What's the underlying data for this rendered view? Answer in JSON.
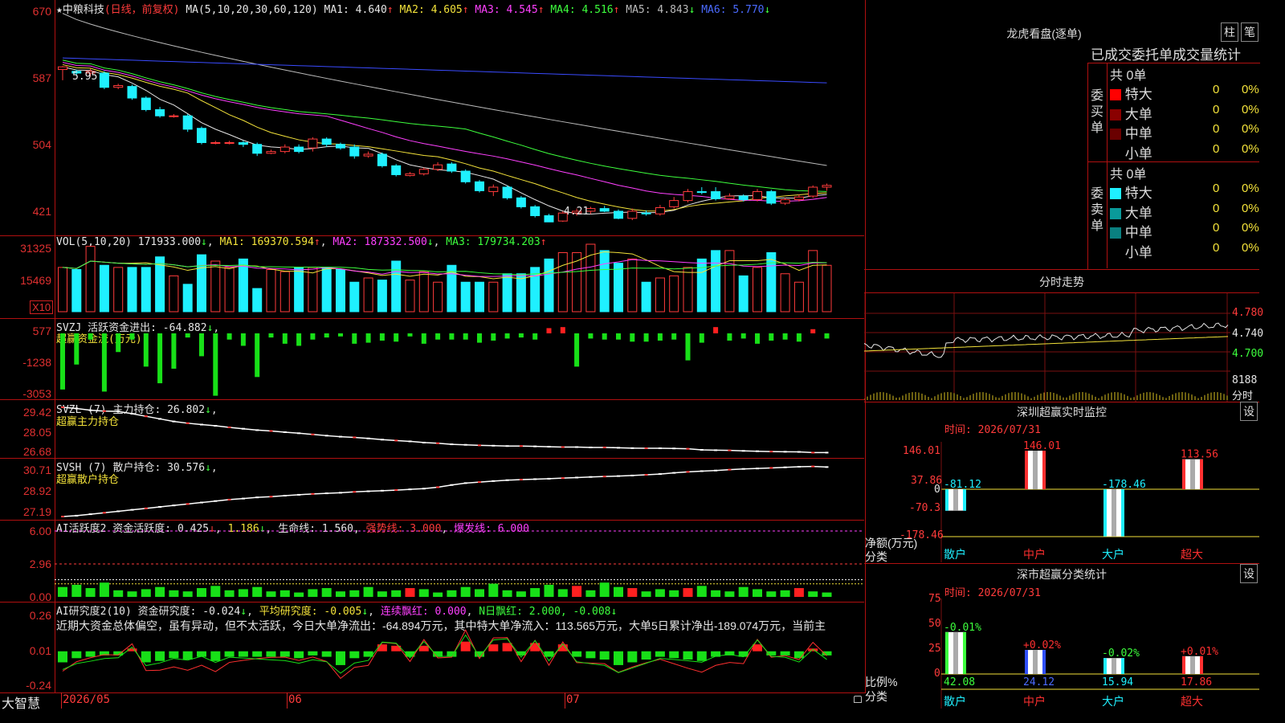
{
  "stock": {
    "name": "中粮科技",
    "mode": "(日线，前复权)"
  },
  "ma_header": {
    "label": "MA(5,10,20,30,60,120)",
    "ma1": "MA1: 4.640",
    "ma2": "MA2: 4.605",
    "ma3": "MA3: 4.545",
    "ma4": "MA4: 4.516",
    "ma5": "MA5: 4.843",
    "ma6": "MA6: 5.770"
  },
  "arrows": {
    "up": "↑",
    "down": "↓"
  },
  "price_axis": [
    "670",
    "587",
    "504",
    "421"
  ],
  "price_annot": {
    "high": "5.95",
    "low": "4.21"
  },
  "vol_header": {
    "label": "VOL(5,10,20)",
    "vol": "171933.000",
    "ma1": "MA1: 169370.594",
    "ma2": "MA2: 187332.500",
    "ma3": "MA3: 179734.203"
  },
  "vol_axis": [
    "31325",
    "15469",
    "X10"
  ],
  "svzj": {
    "label": "SVZJ  活跃资金进出: -64.882",
    "sub": "超赢资金流(万元)",
    "axis": [
      "577",
      "-1238",
      "-3053"
    ]
  },
  "svzl": {
    "label": "SVZL (7) 主力持仓: 26.802",
    "sub": "超赢主力持仓",
    "axis": [
      "29.42",
      "28.05",
      "26.68"
    ]
  },
  "svsh": {
    "label": "SVSH (7) 散户持仓: 30.576",
    "sub": "超赢散户持仓",
    "axis": [
      "30.71",
      "28.92",
      "27.19"
    ]
  },
  "ai1": {
    "label": "AI活跃度2 资金活跃度: 0.425",
    "v2": "1.186",
    "life": "生命线: 1.560",
    "strong": "强势线: 3.000",
    "burst": "爆发线: 6.000",
    "axis": [
      "6.00",
      "2.96",
      "0.00"
    ]
  },
  "ai2": {
    "label": "AI研究度2(10) 资金研究度: -0.024",
    "avg": "平均研究度: -0.005",
    "red": "连续飘红: 0.000",
    "nred": "N日飘红: 2.000, -0.008",
    "commentary": "近期大资金总体偏空，虽有异动，但不太活跃，今日大单净流出：-64.894万元，其中特大单净流入：113.565万元，大单5日累计净出-189.074万元，当前主",
    "axis": [
      "0.26",
      "0.01",
      "-0.24"
    ]
  },
  "xaxis": {
    "brand": "大智慧",
    "dates": [
      "2026/05",
      "06",
      "07"
    ]
  },
  "lhb": {
    "title": "龙虎看盘(逐单)",
    "tabs": [
      "柱",
      "笔"
    ],
    "subtitle": "已成交委托单成交量统计",
    "buy": {
      "side": "委买单",
      "total": "共 0单",
      "rows": [
        {
          "name": "特大",
          "count": "0",
          "pct": "0%",
          "color": "#ff0000"
        },
        {
          "name": "大单",
          "count": "0",
          "pct": "0%",
          "color": "#8a0000"
        },
        {
          "name": "中单",
          "count": "0",
          "pct": "0%",
          "color": "#6a0000"
        },
        {
          "name": "小单",
          "count": "0",
          "pct": "0%",
          "color": "#000000"
        }
      ]
    },
    "sell": {
      "side": "委卖单",
      "total": "共 0单",
      "rows": [
        {
          "name": "特大",
          "count": "0",
          "pct": "0%",
          "color": "#1ff0ff"
        },
        {
          "name": "大单",
          "count": "0",
          "pct": "0%",
          "color": "#0a9a9a"
        },
        {
          "name": "中单",
          "count": "0",
          "pct": "0%",
          "color": "#0a8080"
        },
        {
          "name": "小单",
          "count": "0",
          "pct": "0%",
          "color": "#000000"
        }
      ]
    }
  },
  "intraday": {
    "title": "分时走势",
    "axis": [
      "4.780",
      "4.740",
      "4.700"
    ],
    "vol_max": "8188",
    "vol_label": "分时"
  },
  "sz_monitor": {
    "title": "深圳超赢实时监控",
    "set": "设",
    "time": "时间: 2026/07/31",
    "axis": [
      "146.01",
      "37.86",
      "0",
      "-70.3",
      "-178.46"
    ],
    "ylabel": "净额(万元)",
    "xlabel": "分类",
    "cats": [
      "散户",
      "中户",
      "大户",
      "超大"
    ],
    "values": [
      "-81.12",
      "146.01",
      "-178.46",
      "113.56"
    ]
  },
  "sz_stats": {
    "title": "深市超赢分类统计",
    "set": "设",
    "time": "时间: 2026/07/31",
    "axis": [
      "75",
      "50",
      "25",
      "0"
    ],
    "ylabel": "比例%",
    "xlabel": "分类",
    "cats": [
      "散户",
      "中户",
      "大户",
      "超大"
    ],
    "values": [
      "42.08",
      "24.12",
      "15.94",
      "17.86"
    ],
    "changes": [
      "-0.01%",
      "+0.02%",
      "-0.02%",
      "+0.01%"
    ]
  },
  "chart_data": [
    {
      "type": "candlestick",
      "title": "中粮科技(日线，前复权)",
      "note": "open/close/high/low are estimates read from the price axis",
      "ylim": [
        4.05,
        6.7
      ],
      "ohlc": [
        [
          5.92,
          5.95,
          5.8,
          5.96
        ],
        [
          5.9,
          5.88,
          5.86,
          5.92
        ],
        [
          5.88,
          5.9,
          5.84,
          5.93
        ],
        [
          5.88,
          5.72,
          5.7,
          5.9
        ],
        [
          5.72,
          5.74,
          5.7,
          5.76
        ],
        [
          5.73,
          5.6,
          5.58,
          5.75
        ],
        [
          5.6,
          5.47,
          5.45,
          5.62
        ],
        [
          5.47,
          5.4,
          5.38,
          5.5
        ],
        [
          5.4,
          5.4,
          5.38,
          5.42
        ],
        [
          5.4,
          5.25,
          5.22,
          5.42
        ],
        [
          5.26,
          5.1,
          5.08,
          5.28
        ],
        [
          5.1,
          5.1,
          5.08,
          5.12
        ],
        [
          5.1,
          5.1,
          5.08,
          5.12
        ],
        [
          5.1,
          5.08,
          5.05,
          5.12
        ],
        [
          5.08,
          4.98,
          4.95,
          5.1
        ],
        [
          4.98,
          5.0,
          4.97,
          5.02
        ],
        [
          5.0,
          5.05,
          4.98,
          5.08
        ],
        [
          5.05,
          5.0,
          4.98,
          5.08
        ],
        [
          5.04,
          5.14,
          5.0,
          5.16
        ],
        [
          5.14,
          5.08,
          5.05,
          5.16
        ],
        [
          5.08,
          5.04,
          5.02,
          5.1
        ],
        [
          5.05,
          4.95,
          4.92,
          5.08
        ],
        [
          4.95,
          4.97,
          4.93,
          5.0
        ],
        [
          4.97,
          4.84,
          4.82,
          4.99
        ],
        [
          4.84,
          4.74,
          4.72,
          4.86
        ],
        [
          4.73,
          4.75,
          4.72,
          4.77
        ],
        [
          4.75,
          4.8,
          4.73,
          4.82
        ],
        [
          4.8,
          4.85,
          4.78,
          4.88
        ],
        [
          4.86,
          4.78,
          4.76,
          4.88
        ],
        [
          4.78,
          4.66,
          4.64,
          4.8
        ],
        [
          4.66,
          4.56,
          4.54,
          4.68
        ],
        [
          4.55,
          4.6,
          4.5,
          4.63
        ],
        [
          4.6,
          4.48,
          4.46,
          4.62
        ],
        [
          4.48,
          4.38,
          4.36,
          4.5
        ],
        [
          4.38,
          4.28,
          4.26,
          4.4
        ],
        [
          4.28,
          4.21,
          4.21,
          4.3
        ],
        [
          4.22,
          4.31,
          4.21,
          4.33
        ],
        [
          4.31,
          4.33,
          4.28,
          4.36
        ],
        [
          4.33,
          4.36,
          4.3,
          4.38
        ],
        [
          4.36,
          4.33,
          4.32,
          4.39
        ],
        [
          4.33,
          4.25,
          4.24,
          4.35
        ],
        [
          4.25,
          4.33,
          4.23,
          4.36
        ],
        [
          4.31,
          4.3,
          4.28,
          4.34
        ],
        [
          4.3,
          4.37,
          4.28,
          4.4
        ],
        [
          4.38,
          4.45,
          4.36,
          4.49
        ],
        [
          4.45,
          4.55,
          4.43,
          4.58
        ],
        [
          4.55,
          4.54,
          4.52,
          4.6
        ],
        [
          4.55,
          4.47,
          4.45,
          4.6
        ],
        [
          4.47,
          4.5,
          4.46,
          4.53
        ],
        [
          4.5,
          4.46,
          4.44,
          4.52
        ],
        [
          4.46,
          4.55,
          4.44,
          4.58
        ],
        [
          4.55,
          4.42,
          4.4,
          4.57
        ],
        [
          4.42,
          4.46,
          4.4,
          4.48
        ],
        [
          4.46,
          4.49,
          4.44,
          4.52
        ],
        [
          4.5,
          4.6,
          4.48,
          4.62
        ],
        [
          4.6,
          4.62,
          4.56,
          4.64
        ]
      ]
    },
    {
      "type": "bar",
      "title": "VOL(5,10,20)",
      "note": "volume in units of 10 lots (X10), estimated",
      "values": [
        21,
        20,
        31,
        22,
        21,
        21,
        21,
        26,
        17,
        13,
        27,
        24,
        21,
        25,
        11,
        20,
        19,
        21,
        21,
        21,
        20,
        14,
        16,
        15,
        24,
        15,
        19,
        14,
        22,
        14,
        14,
        14,
        18,
        18,
        21,
        25,
        28,
        28,
        32,
        29,
        23,
        25,
        14,
        16,
        17,
        21,
        25,
        29,
        29,
        17,
        21,
        28,
        18,
        14,
        29,
        22
      ],
      "ma_values": {
        "MA1": 169370.594,
        "MA2": 187332.5,
        "MA3": 179734.203
      }
    },
    {
      "type": "bar",
      "title": "SVZJ 活跃资金进出",
      "ylabel": "超赢资金流(万元)",
      "ylim": [
        -3053,
        577
      ],
      "values": [
        -2700,
        -1500,
        -300,
        -2800,
        -900,
        -300,
        -1600,
        -2400,
        -1700,
        -200,
        -1100,
        -3000,
        -300,
        -600,
        -2100,
        -200,
        -500,
        -600,
        -300,
        -200,
        -150,
        -500,
        -450,
        -350,
        -400,
        -150,
        -500,
        -300,
        -300,
        -300,
        -450,
        -350,
        -250,
        -200,
        -300,
        250,
        300,
        -1600,
        -250,
        -300,
        -300,
        -400,
        -400,
        -350,
        -300,
        -1300,
        -450,
        300,
        -350,
        -250,
        -500,
        -350,
        -300,
        -400,
        200,
        -250
      ]
    },
    {
      "type": "line",
      "title": "SVZL (7) 主力持仓",
      "ylabel": "超赢主力持仓",
      "ylim": [
        26.68,
        29.42
      ],
      "values": [
        29.42,
        29.35,
        29.25,
        29.2,
        29.18,
        29.05,
        28.9,
        28.75,
        28.6,
        28.5,
        28.42,
        28.35,
        28.26,
        28.18,
        28.1,
        28.05,
        27.98,
        27.92,
        27.85,
        27.78,
        27.72,
        27.68,
        27.62,
        27.55,
        27.5,
        27.45,
        27.38,
        27.34,
        27.28,
        27.25,
        27.22,
        27.2,
        27.18,
        27.18,
        27.16,
        27.14,
        27.12,
        27.12,
        27.1,
        27.1,
        27.08,
        27.06,
        27.05,
        27.05,
        27.04,
        27.02,
        26.96,
        26.94,
        26.93,
        26.9,
        26.88,
        26.86,
        26.85,
        26.84,
        26.8,
        26.8
      ]
    },
    {
      "type": "line",
      "title": "SVSH (7) 散户持仓",
      "ylabel": "超赢散户持仓",
      "ylim": [
        27.19,
        30.71
      ],
      "values": [
        27.19,
        27.25,
        27.35,
        27.45,
        27.55,
        27.65,
        27.75,
        27.85,
        27.95,
        28.05,
        28.15,
        28.25,
        28.35,
        28.42,
        28.5,
        28.55,
        28.62,
        28.68,
        28.74,
        28.78,
        28.82,
        28.88,
        28.92,
        28.96,
        29.0,
        29.05,
        29.1,
        29.2,
        29.35,
        29.48,
        29.55,
        29.62,
        29.68,
        29.72,
        29.75,
        29.78,
        29.82,
        29.86,
        29.9,
        29.93,
        29.96,
        30.0,
        30.05,
        30.1,
        30.18,
        30.25,
        30.3,
        30.34,
        30.4,
        30.45,
        30.48,
        30.52,
        30.56,
        30.6,
        30.62,
        30.58
      ]
    },
    {
      "type": "bar",
      "title": "AI活跃度2",
      "ylim": [
        0,
        6.0
      ],
      "lines": {
        "资金活跃度": 0.425,
        "生命线": 1.56,
        "强势线": 3.0,
        "爆发线": 6.0
      },
      "values": [
        0.9,
        1.1,
        0.8,
        1.3,
        0.6,
        0.5,
        0.7,
        0.9,
        0.6,
        0.5,
        0.8,
        1.0,
        0.6,
        0.7,
        0.9,
        0.5,
        0.6,
        0.4,
        0.7,
        0.8,
        0.5,
        0.6,
        0.9,
        0.5,
        0.6,
        0.8,
        0.7,
        0.4,
        0.6,
        0.9,
        0.7,
        1.2,
        0.6,
        0.5,
        0.8,
        1.1,
        0.7,
        1.0,
        0.6,
        1.3,
        0.9,
        0.8,
        0.5,
        0.7,
        0.6,
        0.8,
        1.0,
        0.6,
        0.5,
        0.9,
        0.7,
        0.5,
        0.6,
        0.8,
        0.5,
        0.4
      ]
    },
    {
      "type": "bar",
      "title": "AI研究度2(10)",
      "ylim": [
        -0.24,
        0.26
      ],
      "values": [
        -0.08,
        -0.05,
        -0.04,
        -0.03,
        -0.03,
        0.02,
        -0.08,
        -0.07,
        -0.05,
        -0.06,
        -0.04,
        -0.07,
        -0.04,
        -0.04,
        -0.04,
        -0.04,
        -0.04,
        -0.05,
        -0.03,
        -0.04,
        -0.1,
        -0.05,
        -0.04,
        0.05,
        0.04,
        -0.04,
        0.04,
        -0.04,
        -0.04,
        0.07,
        -0.04,
        0.05,
        0.06,
        -0.03,
        0.06,
        -0.04,
        0.05,
        -0.04,
        -0.05,
        -0.06,
        -0.1,
        -0.08,
        -0.06,
        -0.04,
        -0.05,
        -0.06,
        -0.07,
        -0.04,
        -0.03,
        -0.04,
        0.05,
        -0.03,
        -0.03,
        -0.05,
        0.02,
        -0.03
      ]
    }
  ]
}
